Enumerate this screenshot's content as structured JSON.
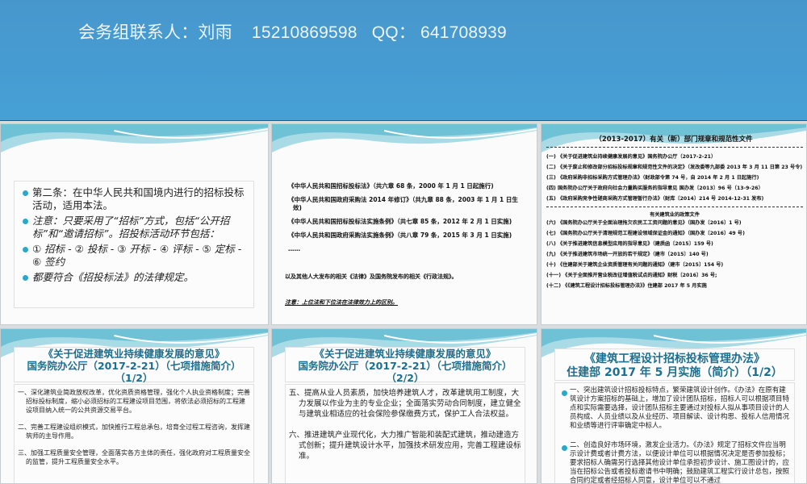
{
  "banner": {
    "contact": "会务组联系人：刘雨    15210869598   QQ： 641708939"
  },
  "slide1": {
    "bullets": [
      "第二条：在中华人民共和国境内进行的招标投标活动，适用本法。",
      "注意：只要采用了“招标”方式，包括“公开招标”和“邀请招标”。招投标活动环节包括：",
      "① 招标 - ② 投标 - ③ 开标 - ④ 评标 - ⑤ 定标 - ⑥ 签约",
      "都要符合《招投标法》的法律规定。"
    ]
  },
  "slide2": {
    "laws": [
      "《中华人民共和国招标投标法》（共六章 68 条，2000 年 1 月 1 日起施行)",
      "《中华人民共和国政府采购法 2014 年修订》（共九章 88 条，2003 年 1 月 1 日生效)",
      "《中华人民共和国招标投标法实施条例》（共七章 85 条，2012 年 2 月 1 日实施)",
      "《中华人民共和国政府采购法实施条例》（共八章 79 条，2015 年 3 月 1 日实施)"
    ],
    "ellipsis": "……",
    "others": "以及其他人大发布的相关《法律》及国务院发布的相关《行政法规》。",
    "note": "注意：上位法和下位法在法律效力上的区别。"
  },
  "slide3": {
    "title": "（2013-2017）有关（新）部门规章和规范性文件",
    "items_a": [
      "(一) 《关于促进建筑业持续健康发展的意见》国务院办公厅（2017-2-21）",
      "(二) 《关于废止和修改部分招标投标规章和规范性文件的决定》（发改委等九部委 2013 年 3 月 11 日第 23 号令)",
      "(三) 《政府采购非招标采购方式管理办法》（财政部令第 74 号，自 2014 年 2 月 1 日起施行)",
      "(四) 国务院办公厅关于政府向社会力量购买服务的指导意见 国办发〔2013〕96 号（13-9-26）",
      "(五) 《政府采购竞争性磋商采购方式管理暂行办法》（财库〔2014〕214 号 2014-12-31 发布)"
    ],
    "subtitle": "有关建筑业的政策文件",
    "items_b": [
      "(六) 《国务院办公厅关于全面治理拖欠农民工工资问题的意见》（国办发〔2016〕1 号)",
      "(七) 《国务院办公厅关于清理规范工程建设领域保证金的通知》（国办发〔2016〕49 号)",
      "(八) 《关于推进建筑信息模型应用的指导意见》（建质函〔2015〕159 号)",
      "(九) 《关于推进建筑市场统一开放的若干规定》（建市〔2015〕140 号)",
      "(十) 《住建部关于建筑企业资质管理有关问题的通知》（建市〔2015〕154 号)",
      "(十一) 《关于全面推开营业税改征增值税试点的通知》财税〔2016〕36 号;",
      "(十二) 《《建筑工程设计招标投标管理办法》》住建部 2017 年 5 月实施"
    ]
  },
  "slide4": {
    "title1": "《关于促进建筑业持续健康发展的意见》",
    "title2": "国务院办公厅（2017-2-21）（七项措施简介）",
    "title3": "（1/2）",
    "paras": [
      "一、深化建筑业简政放权改革，优化资质资格管理，强化个人执业资格制度；完善招标投标制度，缩小必须招标的工程建设项目范围，将依法必须招标的工程建设项目纳入统一的公共资源交易平台。",
      "二、完善工程建设组织模式，加快推行工程总承包，培育全过程工程咨询，发挥建筑师的主导作用。",
      "三、加强工程质量安全管理，全面落实各方主体的责任，强化政府对工程质量安全的监管，提升工程质量安全水平。"
    ]
  },
  "slide5": {
    "title1": "《关于促进建筑业持续健康发展的意见》",
    "title2": "国务院办公厅（2017-2-21）（七项措施简介）",
    "title3": "（2/2）",
    "paras": [
      "五、提高从业人员素质，加快培养建筑人才，改革建筑用工制度，大力发展以作业为主的专业企业；全面落实劳动合同制度，建立健全与建筑业相适应的社会保险参保缴费方式，保护工人合法权益。",
      "六、推进建筑产业现代化，大力推广智能和装配式建筑，推动建造方式创新；提升建筑设计水平，加强技术研发应用，完善工程建设标准。"
    ]
  },
  "slide6": {
    "title1": "《建筑工程设计招标投标管理办法》",
    "title2": "住建部 2017 年 5 月实施（简介）（1/2）",
    "bullets": [
      "一、突出建筑设计招标投标特点，繁荣建筑设计创作。《办法》在原有建筑设计方案招标的基础上，增加了设计团队招标，招标人可以根据项目特点和实际需要选择，设计团队招标主要通过对投标人拟从事项目设计的人员构成、人员业绩以及从业经历、项目解读、设计构思、投标人信用情况和业绩等进行评审确定中标人。",
      "二、创造良好市场环境，激发企业活力。《办法》规定了招标文件应当明示设计费或者计费方法，以便设计单位可以根据情况决定是否参加投标；要求招标人确需另行选择其他设计单位承担初步设计、施工图设计的，应当在招标公告或者投标邀请书中明确；鼓励建筑工程实行设计总包，按照合同约定或者经招标人同意，设计单位可以不通过"
    ]
  }
}
